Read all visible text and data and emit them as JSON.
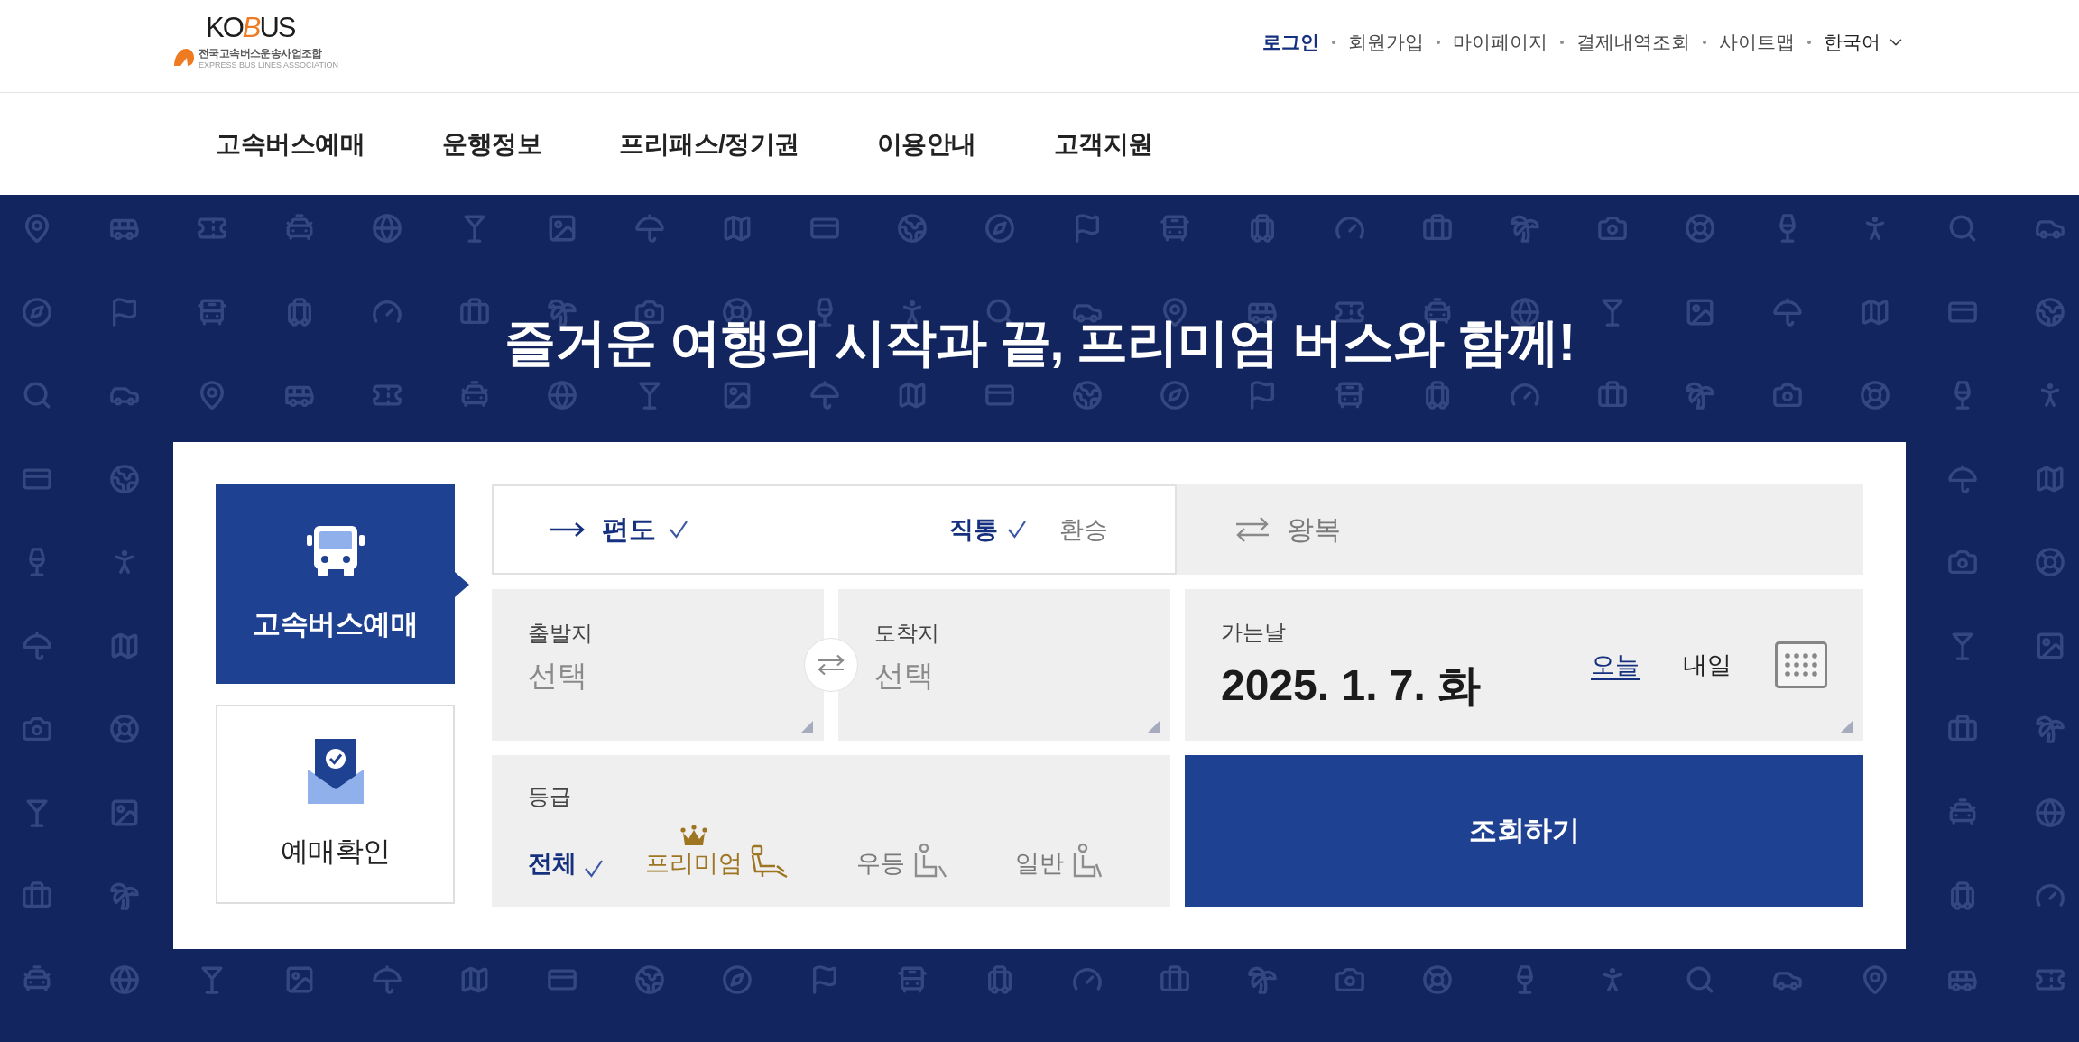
{
  "header": {
    "logo": {
      "wordmark": [
        {
          "text": "KO",
          "accent": false
        },
        {
          "text": "B",
          "accent": true
        },
        {
          "text": "US",
          "accent": false
        }
      ],
      "name": "전국고속버스운송사업조합",
      "tagline": "EXPRESS BUS LINES ASSOCIATION"
    },
    "utility_links": [
      {
        "label": "로그인",
        "kind": "primary"
      },
      {
        "label": "회원가입",
        "kind": "link"
      },
      {
        "label": "마이페이지",
        "kind": "link"
      },
      {
        "label": "결제내역조회",
        "kind": "link"
      },
      {
        "label": "사이트맵",
        "kind": "link"
      },
      {
        "label": "한국어",
        "kind": "dropdown"
      }
    ]
  },
  "main_nav": [
    "고속버스예매",
    "운행정보",
    "프리패스/정기권",
    "이용안내",
    "고객지원"
  ],
  "hero": {
    "title": "즐거운 여행의 시작과 끝, 프리미엄 버스와 함께!"
  },
  "booking": {
    "side_tabs": [
      {
        "label": "고속버스예매",
        "kind": "bus",
        "selected": true
      },
      {
        "label": "예매확인",
        "kind": "reservation-check",
        "selected": false
      }
    ],
    "trip_types": [
      {
        "label": "편도",
        "kind": "one-way",
        "selected": true
      },
      {
        "label": "왕복",
        "kind": "round-trip",
        "selected": false
      }
    ],
    "route_types": [
      {
        "label": "직통",
        "selected": true
      },
      {
        "label": "환승",
        "selected": false
      }
    ],
    "departure": {
      "label": "출발지",
      "placeholder": "선택"
    },
    "arrival": {
      "label": "도착지",
      "placeholder": "선택"
    },
    "date": {
      "label": "가는날",
      "value": "2025. 1. 7. 화",
      "shortcuts": [
        {
          "label": "오늘",
          "selected": true
        },
        {
          "label": "내일",
          "selected": false
        }
      ]
    },
    "grade": {
      "label": "등급",
      "options": [
        {
          "label": "전체",
          "kind": "all",
          "selected": true
        },
        {
          "label": "프리미엄",
          "kind": "premium",
          "selected": false
        },
        {
          "label": "우등",
          "kind": "deluxe",
          "selected": false
        },
        {
          "label": "일반",
          "kind": "standard",
          "selected": false
        }
      ]
    },
    "search_button": "조회하기"
  }
}
